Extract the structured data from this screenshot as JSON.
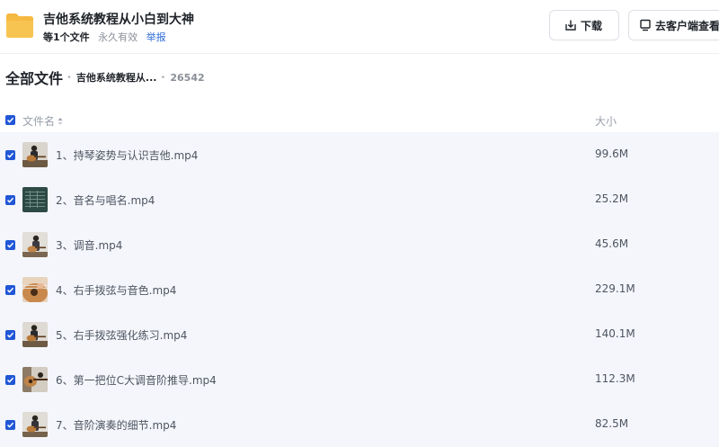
{
  "share": {
    "title": "吉他系统教程从小白到大神",
    "count_text": "等1个文件",
    "validity": "永久有效",
    "report": "举报"
  },
  "actions": {
    "download": "下载",
    "open_client": "去客户端查看"
  },
  "breadcrumb": {
    "root": "全部文件",
    "folder": "吉他系统教程从...",
    "id": "26542"
  },
  "table": {
    "col_name": "文件名",
    "col_size": "大小"
  },
  "files": [
    {
      "name": "1、持琴姿势与认识吉他.mp4",
      "size": "99.6M"
    },
    {
      "name": "2、音名与唱名.mp4",
      "size": "25.2M"
    },
    {
      "name": "3、调音.mp4",
      "size": "45.6M"
    },
    {
      "name": "4、右手拨弦与音色.mp4",
      "size": "229.1M"
    },
    {
      "name": "5、右手拨弦强化练习.mp4",
      "size": "140.1M"
    },
    {
      "name": "6、第一把位C大调音阶推导.mp4",
      "size": "112.3M"
    },
    {
      "name": "7、音阶演奏的细节.mp4",
      "size": "82.5M"
    }
  ],
  "colors": {
    "accent": "#2157d6",
    "link": "#2e6bd6",
    "folder": "#f5b941",
    "row_bg": "#f4f6fb"
  }
}
